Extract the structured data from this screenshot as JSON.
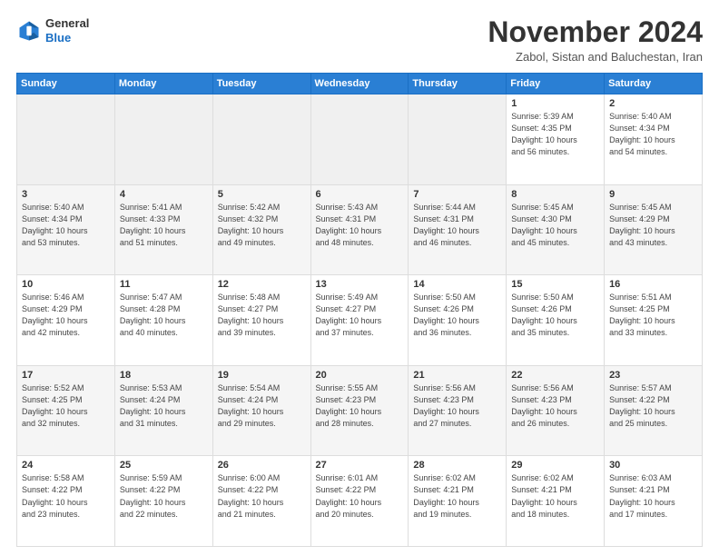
{
  "header": {
    "logo_general": "General",
    "logo_blue": "Blue",
    "month_title": "November 2024",
    "location": "Zabol, Sistan and Baluchestan, Iran"
  },
  "weekdays": [
    "Sunday",
    "Monday",
    "Tuesday",
    "Wednesday",
    "Thursday",
    "Friday",
    "Saturday"
  ],
  "weeks": [
    [
      {
        "day": "",
        "info": ""
      },
      {
        "day": "",
        "info": ""
      },
      {
        "day": "",
        "info": ""
      },
      {
        "day": "",
        "info": ""
      },
      {
        "day": "",
        "info": ""
      },
      {
        "day": "1",
        "info": "Sunrise: 5:39 AM\nSunset: 4:35 PM\nDaylight: 10 hours\nand 56 minutes."
      },
      {
        "day": "2",
        "info": "Sunrise: 5:40 AM\nSunset: 4:34 PM\nDaylight: 10 hours\nand 54 minutes."
      }
    ],
    [
      {
        "day": "3",
        "info": "Sunrise: 5:40 AM\nSunset: 4:34 PM\nDaylight: 10 hours\nand 53 minutes."
      },
      {
        "day": "4",
        "info": "Sunrise: 5:41 AM\nSunset: 4:33 PM\nDaylight: 10 hours\nand 51 minutes."
      },
      {
        "day": "5",
        "info": "Sunrise: 5:42 AM\nSunset: 4:32 PM\nDaylight: 10 hours\nand 49 minutes."
      },
      {
        "day": "6",
        "info": "Sunrise: 5:43 AM\nSunset: 4:31 PM\nDaylight: 10 hours\nand 48 minutes."
      },
      {
        "day": "7",
        "info": "Sunrise: 5:44 AM\nSunset: 4:31 PM\nDaylight: 10 hours\nand 46 minutes."
      },
      {
        "day": "8",
        "info": "Sunrise: 5:45 AM\nSunset: 4:30 PM\nDaylight: 10 hours\nand 45 minutes."
      },
      {
        "day": "9",
        "info": "Sunrise: 5:45 AM\nSunset: 4:29 PM\nDaylight: 10 hours\nand 43 minutes."
      }
    ],
    [
      {
        "day": "10",
        "info": "Sunrise: 5:46 AM\nSunset: 4:29 PM\nDaylight: 10 hours\nand 42 minutes."
      },
      {
        "day": "11",
        "info": "Sunrise: 5:47 AM\nSunset: 4:28 PM\nDaylight: 10 hours\nand 40 minutes."
      },
      {
        "day": "12",
        "info": "Sunrise: 5:48 AM\nSunset: 4:27 PM\nDaylight: 10 hours\nand 39 minutes."
      },
      {
        "day": "13",
        "info": "Sunrise: 5:49 AM\nSunset: 4:27 PM\nDaylight: 10 hours\nand 37 minutes."
      },
      {
        "day": "14",
        "info": "Sunrise: 5:50 AM\nSunset: 4:26 PM\nDaylight: 10 hours\nand 36 minutes."
      },
      {
        "day": "15",
        "info": "Sunrise: 5:50 AM\nSunset: 4:26 PM\nDaylight: 10 hours\nand 35 minutes."
      },
      {
        "day": "16",
        "info": "Sunrise: 5:51 AM\nSunset: 4:25 PM\nDaylight: 10 hours\nand 33 minutes."
      }
    ],
    [
      {
        "day": "17",
        "info": "Sunrise: 5:52 AM\nSunset: 4:25 PM\nDaylight: 10 hours\nand 32 minutes."
      },
      {
        "day": "18",
        "info": "Sunrise: 5:53 AM\nSunset: 4:24 PM\nDaylight: 10 hours\nand 31 minutes."
      },
      {
        "day": "19",
        "info": "Sunrise: 5:54 AM\nSunset: 4:24 PM\nDaylight: 10 hours\nand 29 minutes."
      },
      {
        "day": "20",
        "info": "Sunrise: 5:55 AM\nSunset: 4:23 PM\nDaylight: 10 hours\nand 28 minutes."
      },
      {
        "day": "21",
        "info": "Sunrise: 5:56 AM\nSunset: 4:23 PM\nDaylight: 10 hours\nand 27 minutes."
      },
      {
        "day": "22",
        "info": "Sunrise: 5:56 AM\nSunset: 4:23 PM\nDaylight: 10 hours\nand 26 minutes."
      },
      {
        "day": "23",
        "info": "Sunrise: 5:57 AM\nSunset: 4:22 PM\nDaylight: 10 hours\nand 25 minutes."
      }
    ],
    [
      {
        "day": "24",
        "info": "Sunrise: 5:58 AM\nSunset: 4:22 PM\nDaylight: 10 hours\nand 23 minutes."
      },
      {
        "day": "25",
        "info": "Sunrise: 5:59 AM\nSunset: 4:22 PM\nDaylight: 10 hours\nand 22 minutes."
      },
      {
        "day": "26",
        "info": "Sunrise: 6:00 AM\nSunset: 4:22 PM\nDaylight: 10 hours\nand 21 minutes."
      },
      {
        "day": "27",
        "info": "Sunrise: 6:01 AM\nSunset: 4:22 PM\nDaylight: 10 hours\nand 20 minutes."
      },
      {
        "day": "28",
        "info": "Sunrise: 6:02 AM\nSunset: 4:21 PM\nDaylight: 10 hours\nand 19 minutes."
      },
      {
        "day": "29",
        "info": "Sunrise: 6:02 AM\nSunset: 4:21 PM\nDaylight: 10 hours\nand 18 minutes."
      },
      {
        "day": "30",
        "info": "Sunrise: 6:03 AM\nSunset: 4:21 PM\nDaylight: 10 hours\nand 17 minutes."
      }
    ]
  ]
}
